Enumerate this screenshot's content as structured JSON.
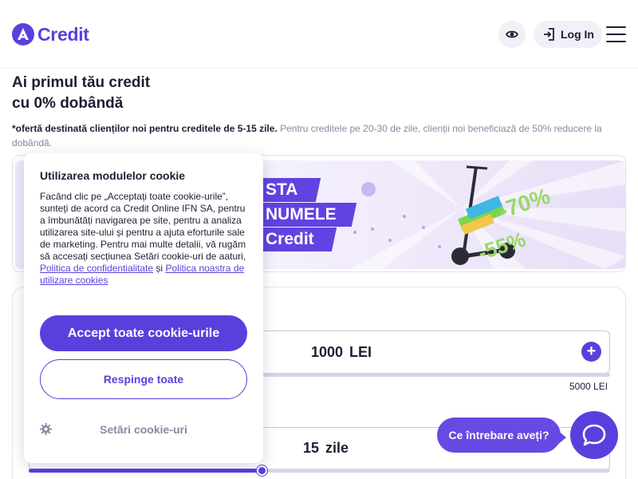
{
  "header": {
    "brand": "Credit",
    "login_label": "Log In",
    "eye_icon": "eye-icon",
    "menu_icon": "hamburger-menu-icon"
  },
  "hero": {
    "title_line1": "Ai primul tău credit",
    "title_line2": "cu 0% dobândă",
    "note_bold": "*ofertă destinată clienților noi pentru creditele de 5-15 zile.",
    "note_rest": " Pentru creditele pe 20-30 de zile, clienții noi beneficiază de 50% reducere la dobândă."
  },
  "banner": {
    "strip1": "STA",
    "strip2": "NUMELE",
    "strip3": "Credit",
    "tag1": "-70%",
    "tag2": "-55%"
  },
  "calculator": {
    "amount_value": "1000 LEI",
    "max_amount": "5000 LEI",
    "plus_label": "+",
    "days_value": "15 zile",
    "days_fraction": 0.4
  },
  "cookie": {
    "title": "Utilizarea modulelor cookie",
    "body": "Facând clic pe „Acceptați toate cookie-urile”, sunteți de acord ca Credit Online IFN SA, pentru a îmbunătăți navigarea pe site, pentru a analiza utilizarea site-ului și pentru a ajuta eforturile sale de marketing. Pentru mai multe detalii, vă rugăm să accesați secțiunea Setări cookie-uri de aaturi, ",
    "link1": "Politica de confidentialitate",
    "and": " și ",
    "link2": "Politica noastra de utilizare cookies",
    "accept_label": "Accept toate cookie-urile",
    "reject_label": "Respinge toate",
    "settings_label": "Setări cookie-uri"
  },
  "chat": {
    "bubble_label": "Ce întrebare aveți?"
  },
  "colors": {
    "brand": "#5b3fdc",
    "text": "#1f1d33",
    "muted": "#8a88a0"
  }
}
